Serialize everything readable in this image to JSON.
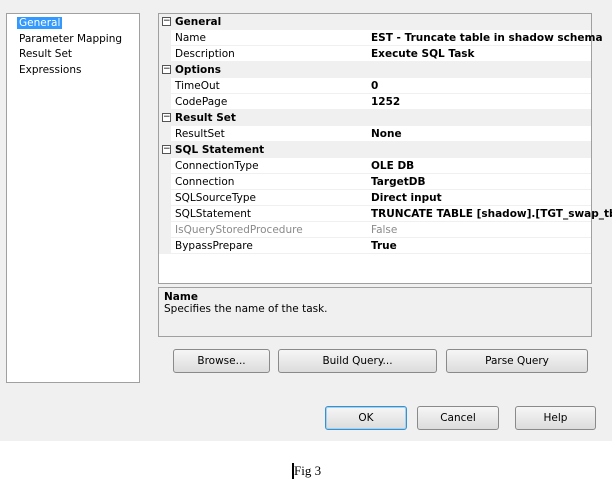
{
  "nav": {
    "items": [
      {
        "label": "General",
        "selected": true
      },
      {
        "label": "Parameter Mapping"
      },
      {
        "label": "Result Set"
      },
      {
        "label": "Expressions"
      }
    ]
  },
  "grid": {
    "rows": [
      {
        "type": "cat",
        "label": "General"
      },
      {
        "type": "prop",
        "label": "Name",
        "value": "EST - Truncate table in shadow schema"
      },
      {
        "type": "prop",
        "label": "Description",
        "value": "Execute SQL Task"
      },
      {
        "type": "cat",
        "label": "Options"
      },
      {
        "type": "prop",
        "label": "TimeOut",
        "value": "0"
      },
      {
        "type": "prop",
        "label": "CodePage",
        "value": "1252"
      },
      {
        "type": "cat",
        "label": "Result Set"
      },
      {
        "type": "prop",
        "label": "ResultSet",
        "value": "None"
      },
      {
        "type": "cat",
        "label": "SQL Statement"
      },
      {
        "type": "prop",
        "label": "ConnectionType",
        "value": "OLE DB"
      },
      {
        "type": "prop",
        "label": "Connection",
        "value": "TargetDB"
      },
      {
        "type": "prop",
        "label": "SQLSourceType",
        "value": "Direct input"
      },
      {
        "type": "prop",
        "label": "SQLStatement",
        "value": "TRUNCATE TABLE [shadow].[TGT_swap_tbl]"
      },
      {
        "type": "prop",
        "label": "IsQueryStoredProcedure",
        "value": "False",
        "disabled": true
      },
      {
        "type": "prop",
        "label": "BypassPrepare",
        "value": "True"
      }
    ],
    "collapse_glyph": "⊟"
  },
  "description": {
    "title": "Name",
    "text": "Specifies the name of the task."
  },
  "buttons": {
    "browse": "Browse...",
    "build_query": "Build Query...",
    "parse_query": "Parse Query",
    "ok": "OK",
    "cancel": "Cancel",
    "help": "Help"
  },
  "caption": "Fig 3"
}
